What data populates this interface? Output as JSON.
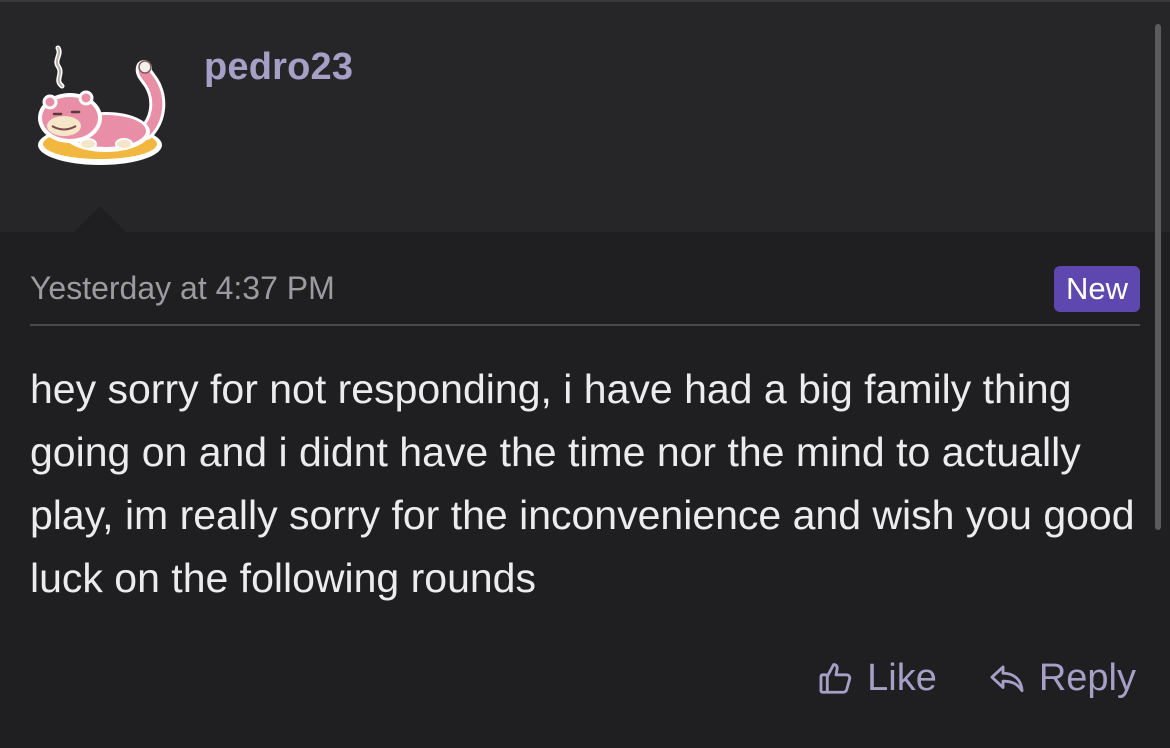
{
  "post": {
    "username": "pedro23",
    "avatar_icon": "slowpoke-avatar-icon",
    "timestamp": "Yesterday at 4:37 PM",
    "badge": "New",
    "message": "hey sorry for not responding, i have had a big family thing going on and i didnt have the time nor the mind to actually play, im really sorry for the inconvenience and wish you good luck on the following rounds"
  },
  "actions": {
    "like_label": "Like",
    "like_icon": "thumbs-up-icon",
    "reply_label": "Reply",
    "reply_icon": "reply-arrow-icon"
  },
  "colors": {
    "accent": "#a69fc6",
    "badge_bg": "#5f47b0",
    "header_bg": "#262628",
    "body_bg": "#1f1f21",
    "text": "#ececee",
    "muted": "#9c9ca0"
  }
}
